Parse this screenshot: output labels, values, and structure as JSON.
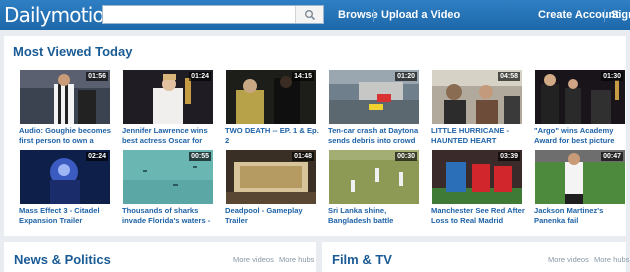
{
  "header": {
    "logo": "Dailymotion",
    "search_placeholder": "",
    "nav": {
      "browse": "Browse",
      "upload": "Upload a Video",
      "create_account": "Create Account",
      "sign": "Sign"
    }
  },
  "most_viewed": {
    "title": "Most Viewed Today",
    "videos": [
      {
        "duration": "01:56",
        "title": "Audio: Goughie becomes first person to own a"
      },
      {
        "duration": "01:24",
        "title": "Jennifer Lawrence wins best actress Oscar for"
      },
      {
        "duration": "14:15",
        "title": "TWO DEATH -- EP. 1 & Ep. 2"
      },
      {
        "duration": "01:20",
        "title": "Ten-car crash at Daytona sends debris into crowd"
      },
      {
        "duration": "04:58",
        "title": "LITTLE HURRICANE - HAUNTED HEART"
      },
      {
        "duration": "01:30",
        "title": "\"Argo\" wins Academy Award for best picture"
      },
      {
        "duration": "02:24",
        "title": "Mass Effect 3 - Citadel Expansion Trailer"
      },
      {
        "duration": "00:55",
        "title": "Thousands of sharks invade Florida's waters -"
      },
      {
        "duration": "01:48",
        "title": "Deadpool - Gameplay Trailer"
      },
      {
        "duration": "00:30",
        "title": "Sri Lanka shine, Bangladesh battle"
      },
      {
        "duration": "03:39",
        "title": "Manchester See Red After Loss to Real Madrid"
      },
      {
        "duration": "00:47",
        "title": "Jackson Martinez's Panenka fail"
      }
    ]
  },
  "news": {
    "title": "News & Politics",
    "more_videos": "More videos",
    "more_hubs": "More hubs"
  },
  "film": {
    "title": "Film & TV",
    "more_videos": "More videos",
    "more_hubs": "More hubs"
  },
  "colors": {
    "header": "#2069ab",
    "link": "#1e62a6",
    "section_title": "#1a5b95"
  }
}
